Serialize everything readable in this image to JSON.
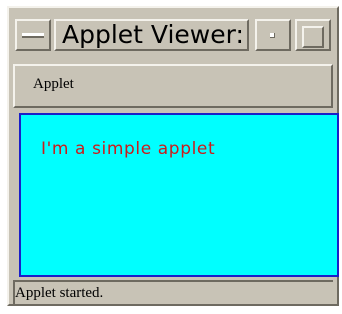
{
  "window": {
    "title": "Applet Viewer:"
  },
  "menubar": {
    "items": [
      {
        "label": "Applet"
      }
    ]
  },
  "applet": {
    "text": "I'm a simple applet",
    "background_color": "#00ffff",
    "text_color": "#cc1a1a"
  },
  "status": {
    "text": "Applet started."
  }
}
